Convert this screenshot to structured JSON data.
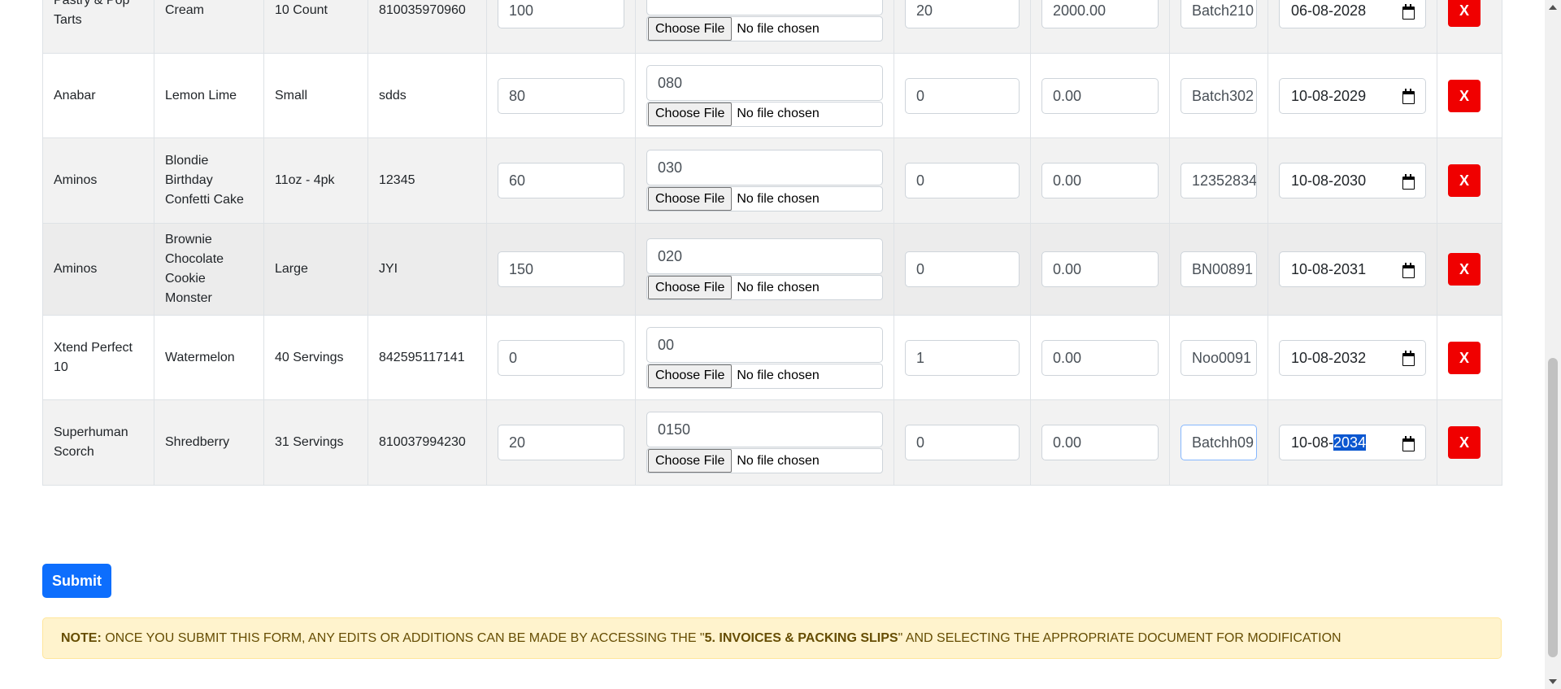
{
  "table": {
    "rows": [
      {
        "brand": "Pastry & Pop Tarts",
        "flavor": "Cream",
        "size": "10 Count",
        "upc": "810035970960",
        "qty": "100",
        "case_value": "",
        "file_button": "Choose File",
        "file_status": "No file chosen",
        "units": "20",
        "cost": "2000.00",
        "batch": "Batch210",
        "expiry_prefix": "06-08-",
        "expiry_year": "2028",
        "delete_label": "X"
      },
      {
        "brand": "Anabar",
        "flavor": "Lemon Lime",
        "size": "Small",
        "upc": "sdds",
        "qty": "80",
        "case_value": "080",
        "file_button": "Choose File",
        "file_status": "No file chosen",
        "units": "0",
        "cost": "0.00",
        "batch": "Batch302",
        "expiry_prefix": "10-08-",
        "expiry_year": "2029",
        "delete_label": "X"
      },
      {
        "brand": "Aminos",
        "flavor": "Blondie Birthday Confetti Cake",
        "size": "11oz - 4pk",
        "upc": "12345",
        "qty": "60",
        "case_value": "030",
        "file_button": "Choose File",
        "file_status": "No file chosen",
        "units": "0",
        "cost": "0.00",
        "batch": "12352834",
        "expiry_prefix": "10-08-",
        "expiry_year": "2030",
        "delete_label": "X"
      },
      {
        "brand": "Aminos",
        "flavor": "Brownie Chocolate Cookie Monster",
        "size": "Large",
        "upc": "JYI",
        "qty": "150",
        "case_value": "020",
        "file_button": "Choose File",
        "file_status": "No file chosen",
        "units": "0",
        "cost": "0.00",
        "batch": "BN00891",
        "expiry_prefix": "10-08-",
        "expiry_year": "2031",
        "delete_label": "X"
      },
      {
        "brand": "Xtend Perfect 10",
        "flavor": "Watermelon",
        "size": "40 Servings",
        "upc": "842595117141",
        "qty": "0",
        "case_value": "00",
        "file_button": "Choose File",
        "file_status": "No file chosen",
        "units": "1",
        "cost": "0.00",
        "batch": "Noo0091",
        "expiry_prefix": "10-08-",
        "expiry_year": "2032",
        "delete_label": "X"
      },
      {
        "brand": "Superhuman Scorch",
        "flavor": "Shredberry",
        "size": "31 Servings",
        "upc": "810037994230",
        "qty": "20",
        "case_value": "0150",
        "file_button": "Choose File",
        "file_status": "No file chosen",
        "units": "0",
        "cost": "0.00",
        "batch": "Batchh09",
        "expiry_prefix": "10-08-",
        "expiry_year": "2034",
        "delete_label": "X"
      }
    ]
  },
  "submit_label": "Submit",
  "note": {
    "prefix": "NOTE:",
    "text_before": " Once you submit this form, any edits or additions can be made by accessing the \"",
    "link": "5. Invoices & Packing Slips",
    "text_after": "\" and selecting the appropriate document for modification"
  },
  "colors": {
    "primary": "#0d6efd",
    "danger": "#f00000",
    "note_bg": "#fff3cd",
    "note_text": "#664d03"
  },
  "icons": {
    "date_picker": "calendar-icon",
    "delete": "close-icon"
  }
}
